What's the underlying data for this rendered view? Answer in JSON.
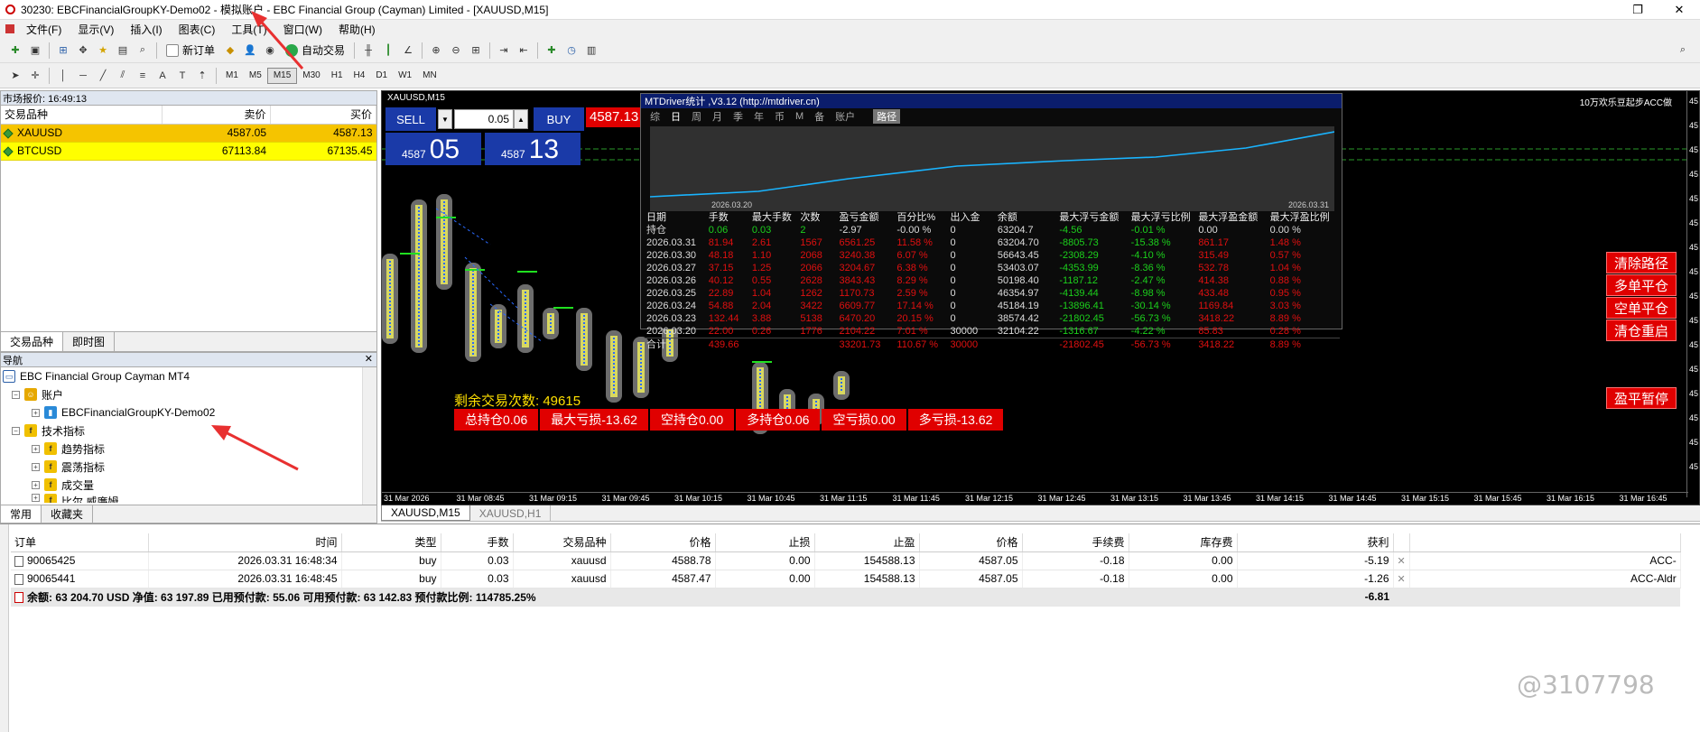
{
  "window": {
    "title": "30230: EBCFinancialGroupKY-Demo02 - 模拟账户 - EBC Financial Group (Cayman) Limited - [XAUUSD,M15]"
  },
  "menu": [
    "文件(F)",
    "显示(V)",
    "插入(I)",
    "图表(C)",
    "工具(T)",
    "窗口(W)",
    "帮助(H)"
  ],
  "toolbar": {
    "new_order": "新订单",
    "auto_trading": "自动交易",
    "timeframes": [
      "M1",
      "M5",
      "M15",
      "M30",
      "H1",
      "H4",
      "D1",
      "W1",
      "MN"
    ]
  },
  "market_watch": {
    "title": "市场报价: 16:49:13",
    "columns": [
      "交易品种",
      "卖价",
      "买价"
    ],
    "rows": [
      {
        "symbol": "XAUUSD",
        "bid": "4587.05",
        "ask": "4587.13"
      },
      {
        "symbol": "BTCUSD",
        "bid": "67113.84",
        "ask": "67135.45"
      }
    ],
    "tabs": [
      "交易品种",
      "即时图"
    ]
  },
  "navigator": {
    "title": "导航",
    "broker": "EBC Financial Group Cayman MT4",
    "accounts_label": "账户",
    "account": "EBCFinancialGroupKY-Demo02",
    "indicators_label": "技术指标",
    "indicator_groups": [
      "趋势指标",
      "震荡指标",
      "成交量",
      "比尔.威廉姆"
    ],
    "tabs": [
      "常用",
      "收藏夹"
    ]
  },
  "chart": {
    "title": "XAUUSD,M15",
    "top_right": "10万欢乐豆起步ACC做",
    "order_panel": {
      "sell": "SELL",
      "buy": "BUY",
      "lot": "0.05",
      "bid_small": "4587",
      "bid_big": "05",
      "ask_small": "4587",
      "ask_big": "13",
      "ask_price": "4587.13"
    },
    "remaining_trades": "剩余交易次数:  49615",
    "stats": [
      "总持仓0.06",
      "最大亏损-13.62",
      "空持仓0.00",
      "多持仓0.06",
      "空亏损0.00",
      "多亏损-13.62"
    ],
    "right_buttons": [
      "清除路径",
      "多单平仓",
      "空单平仓",
      "清仓重启",
      "盈平暂停"
    ],
    "time_labels": [
      "31 Mar 2026",
      "31 Mar 08:45",
      "31 Mar 09:15",
      "31 Mar 09:45",
      "31 Mar 10:15",
      "31 Mar 10:45",
      "31 Mar 11:15",
      "31 Mar 11:45",
      "31 Mar 12:15",
      "31 Mar 12:45",
      "31 Mar 13:15",
      "31 Mar 13:45",
      "31 Mar 14:15",
      "31 Mar 14:45",
      "31 Mar 15:15",
      "31 Mar 15:45",
      "31 Mar 16:15",
      "31 Mar 16:45"
    ],
    "price_labels": [
      "45",
      "45",
      "45",
      "45",
      "45",
      "45",
      "45",
      "45",
      "45",
      "45",
      "45",
      "45",
      "45",
      "45",
      "45",
      "45"
    ],
    "chart_tabs": [
      "XAUUSD,M15",
      "XAUUSD,H1"
    ]
  },
  "mtdriver": {
    "title": "MTDriver统计 ,V3.12 (http://mtdriver.cn)",
    "nav": [
      "综",
      "日",
      "周",
      "月",
      "季",
      "年",
      "币",
      "M",
      "备",
      "账户"
    ],
    "path": "路径",
    "date_start": "2026.03.20",
    "date_end": "2026.03.31",
    "columns": [
      "日期",
      "手数",
      "最大手数",
      "次数",
      "盈亏金额",
      "百分比%",
      "出入金",
      "余额",
      "最大浮亏金额",
      "最大浮亏比例",
      "最大浮盈金额",
      "最大浮盈比例"
    ],
    "position": [
      "持仓",
      "0.06",
      "0.03",
      "2",
      "-2.97",
      "-0.00 %",
      "0",
      "63204.7",
      "-4.56",
      "-0.01 %",
      "0.00",
      "0.00 %"
    ],
    "rows": [
      [
        "2026.03.31",
        "81.94",
        "2.61",
        "1567",
        "6561.25",
        "11.58 %",
        "0",
        "63204.70",
        "-8805.73",
        "-15.38 %",
        "861.17",
        "1.48 %"
      ],
      [
        "2026.03.30",
        "48.18",
        "1.10",
        "2068",
        "3240.38",
        "6.07 %",
        "0",
        "56643.45",
        "-2308.29",
        "-4.10 %",
        "315.49",
        "0.57 %"
      ],
      [
        "2026.03.27",
        "37.15",
        "1.25",
        "2066",
        "3204.67",
        "6.38 %",
        "0",
        "53403.07",
        "-4353.99",
        "-8.36 %",
        "532.78",
        "1.04 %"
      ],
      [
        "2026.03.26",
        "40.12",
        "0.55",
        "2628",
        "3843.43",
        "8.29 %",
        "0",
        "50198.40",
        "-1187.12",
        "-2.47 %",
        "414.38",
        "0.88 %"
      ],
      [
        "2026.03.25",
        "22.89",
        "1.04",
        "1262",
        "1170.73",
        "2.59 %",
        "0",
        "46354.97",
        "-4139.44",
        "-8.98 %",
        "433.48",
        "0.95 %"
      ],
      [
        "2026.03.24",
        "54.88",
        "2.04",
        "3422",
        "6609.77",
        "17.14 %",
        "0",
        "45184.19",
        "-13896.41",
        "-30.14 %",
        "1169.84",
        "3.03 %"
      ],
      [
        "2026.03.23",
        "132.44",
        "3.88",
        "5138",
        "6470.20",
        "20.15 %",
        "0",
        "38574.42",
        "-21802.45",
        "-56.73 %",
        "3418.22",
        "8.89 %"
      ],
      [
        "2026.03.20",
        "22.00",
        "0.26",
        "1776",
        "2104.22",
        "7.01 %",
        "30000",
        "32104.22",
        "-1316.67",
        "-4.22 %",
        "85.83",
        "0.28 %"
      ]
    ],
    "total": [
      "合计",
      "439.66",
      "",
      "",
      "33201.73",
      "110.67 %",
      "30000",
      "",
      "-21802.45",
      "-56.73 %",
      "3418.22",
      "8.89 %"
    ]
  },
  "terminal": {
    "columns": [
      "订单",
      "时间",
      "类型",
      "手数",
      "交易品种",
      "价格",
      "止损",
      "止盈",
      "价格",
      "手续费",
      "库存费",
      "获利"
    ],
    "rows": [
      {
        "order": "90065425",
        "time": "2026.03.31 16:48:34",
        "type": "buy",
        "lots": "0.03",
        "symbol": "xauusd",
        "price": "4588.78",
        "sl": "0.00",
        "tp": "154588.13",
        "cur": "4587.05",
        "commission": "-0.18",
        "swap": "0.00",
        "profit": "-5.19",
        "comment": "ACC-"
      },
      {
        "order": "90065441",
        "time": "2026.03.31 16:48:45",
        "type": "buy",
        "lots": "0.03",
        "symbol": "xauusd",
        "price": "4587.47",
        "sl": "0.00",
        "tp": "154588.13",
        "cur": "4587.05",
        "commission": "-0.18",
        "swap": "0.00",
        "profit": "-1.26",
        "comment": "ACC-Aldr"
      }
    ],
    "balance_line": "余额: 63 204.70 USD  净值: 63 197.89  已用预付款: 55.06  可用预付款: 63 142.83  预付款比例: 114785.25%",
    "total_profit": "-6.81"
  },
  "watermark": "@3107798"
}
